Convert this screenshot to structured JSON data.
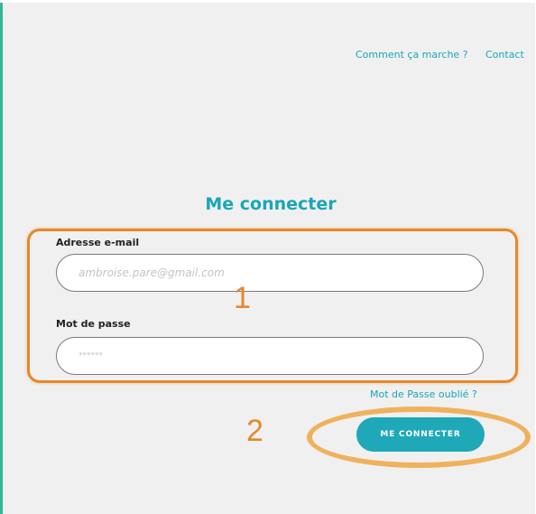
{
  "header": {
    "nav_how_it_works": "Comment ça marche ?",
    "nav_contact": "Contact"
  },
  "login": {
    "title": "Me connecter",
    "email_label": "Adresse e-mail",
    "email_placeholder": "ambroise.pare@gmail.com",
    "password_label": "Mot de passe",
    "password_placeholder": "******",
    "forgot_password": "Mot de Passe oublié ?",
    "submit_label": "ME CONNECTER"
  },
  "annotations": {
    "box_number": "1",
    "button_number": "2"
  },
  "colors": {
    "brand_teal": "#1aa6b7",
    "accent_green": "#2fb89a",
    "annotation_orange": "#e5882a",
    "page_background": "#f0f0f0"
  }
}
